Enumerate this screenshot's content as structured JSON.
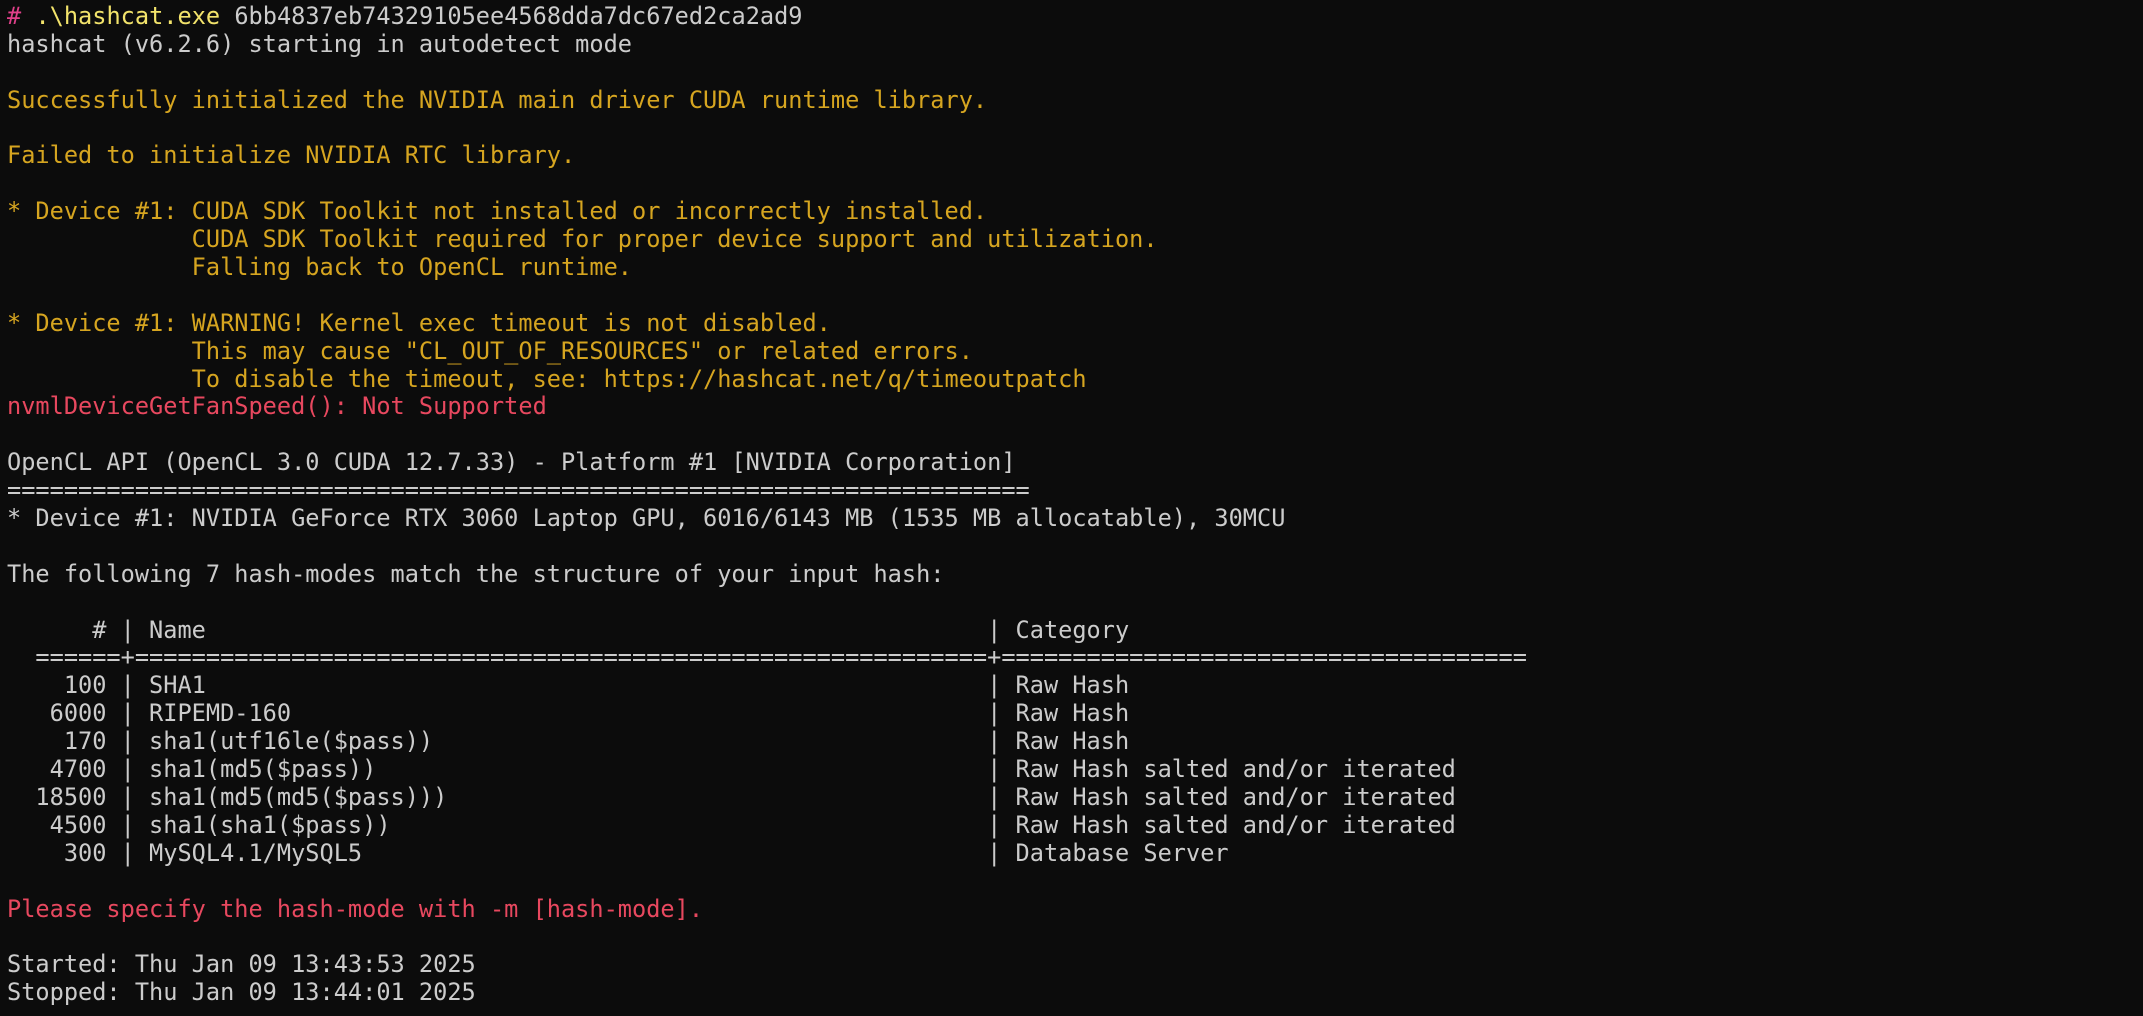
{
  "command": {
    "prompt": "#",
    "executable": ".\\hashcat.exe",
    "argument": "6bb4837eb74329105ee4568dda7dc67ed2ca2ad9"
  },
  "startup": {
    "version_line": "hashcat (v6.2.6) starting in autodetect mode"
  },
  "messages": {
    "cuda_ok": "Successfully initialized the NVIDIA main driver CUDA runtime library.",
    "rtc_fail": "Failed to initialize NVIDIA RTC library.",
    "device_cuda_1": "* Device #1: CUDA SDK Toolkit not installed or incorrectly installed.",
    "device_cuda_2": "             CUDA SDK Toolkit required for proper device support and utilization.",
    "device_cuda_3": "             Falling back to OpenCL runtime.",
    "device_timeout_1": "* Device #1: WARNING! Kernel exec timeout is not disabled.",
    "device_timeout_2": "             This may cause \"CL_OUT_OF_RESOURCES\" or related errors.",
    "device_timeout_3": "             To disable the timeout, see: https://hashcat.net/q/timeoutpatch",
    "fan_speed": "nvmlDeviceGetFanSpeed(): Not Supported"
  },
  "platform": {
    "header": "OpenCL API (OpenCL 3.0 CUDA 12.7.33) - Platform #1 [NVIDIA Corporation]",
    "separator": "========================================================================",
    "device": "* Device #1: NVIDIA GeForce RTX 3060 Laptop GPU, 6016/6143 MB (1535 MB allocatable), 30MCU"
  },
  "hash_modes": {
    "intro": "The following 7 hash-modes match the structure of your input hash:",
    "header": "      # | Name                                                       | Category",
    "separator": "  ======+============================================================+=====================================",
    "rows": [
      "    100 | SHA1                                                       | Raw Hash",
      "   6000 | RIPEMD-160                                                 | Raw Hash",
      "    170 | sha1(utf16le($pass))                                       | Raw Hash",
      "   4700 | sha1(md5($pass))                                           | Raw Hash salted and/or iterated",
      "  18500 | sha1(md5(md5($pass)))                                      | Raw Hash salted and/or iterated",
      "   4500 | sha1(sha1($pass))                                          | Raw Hash salted and/or iterated",
      "    300 | MySQL4.1/MySQL5                                            | Database Server"
    ]
  },
  "footer": {
    "specify": "Please specify the hash-mode with -m [hash-mode].",
    "started": "Started: Thu Jan 09 13:43:53 2025",
    "stopped": "Stopped: Thu Jan 09 13:44:01 2025"
  }
}
